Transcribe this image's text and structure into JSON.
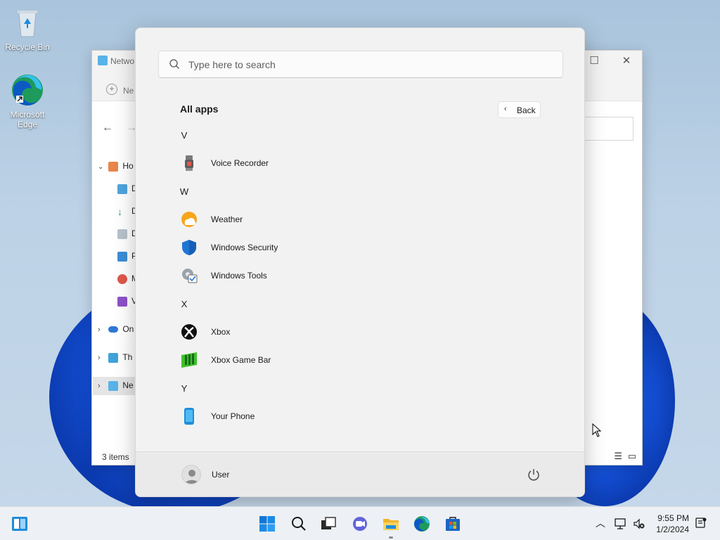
{
  "desktop": {
    "icons": [
      {
        "label": "Recycle Bin",
        "icon": "recycle-bin-icon"
      },
      {
        "label": "Microsoft Edge",
        "icon": "edge-icon"
      }
    ]
  },
  "explorer": {
    "title": "Netwo",
    "new_label": "Ne",
    "tree": [
      {
        "label": "Ho",
        "icon": "home-icon"
      },
      {
        "label": "D",
        "icon": "desktop-folder-icon"
      },
      {
        "label": "D",
        "icon": "downloads-icon"
      },
      {
        "label": "D",
        "icon": "documents-icon"
      },
      {
        "label": "P",
        "icon": "pictures-icon"
      },
      {
        "label": "M",
        "icon": "music-icon"
      },
      {
        "label": "V",
        "icon": "videos-icon"
      },
      {
        "label": "On",
        "icon": "onedrive-icon"
      },
      {
        "label": "Th",
        "icon": "this-pc-icon"
      },
      {
        "label": "Ne",
        "icon": "network-icon"
      }
    ],
    "status": "3 items"
  },
  "start_menu": {
    "search_placeholder": "Type here to search",
    "all_apps_title": "All apps",
    "back_label": "Back",
    "sections": [
      {
        "letter": "V",
        "apps": [
          {
            "name": "Voice Recorder",
            "icon": "voice-recorder-icon"
          }
        ]
      },
      {
        "letter": "W",
        "apps": [
          {
            "name": "Weather",
            "icon": "weather-icon"
          },
          {
            "name": "Windows Security",
            "icon": "windows-security-icon"
          },
          {
            "name": "Windows Tools",
            "icon": "windows-tools-icon"
          }
        ]
      },
      {
        "letter": "X",
        "apps": [
          {
            "name": "Xbox",
            "icon": "xbox-icon"
          },
          {
            "name": "Xbox Game Bar",
            "icon": "xbox-game-bar-icon"
          }
        ]
      },
      {
        "letter": "Y",
        "apps": [
          {
            "name": "Your Phone",
            "icon": "your-phone-icon"
          }
        ]
      }
    ],
    "user_name": "User"
  },
  "taskbar": {
    "time": "9:55 PM",
    "date": "1/2/2024",
    "accent": "#0067c0"
  }
}
